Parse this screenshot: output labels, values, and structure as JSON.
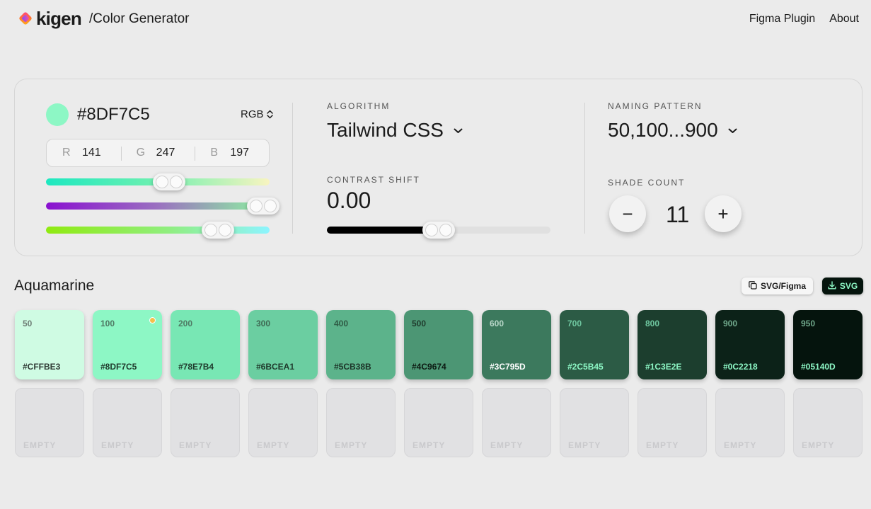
{
  "header": {
    "logo_text": "kigen",
    "title": "/Color Generator",
    "nav": [
      "Figma Plugin",
      "About"
    ]
  },
  "color_input": {
    "hex": "#8DF7C5",
    "swatch_color": "#8DF7C5",
    "mode": "RGB",
    "channels": [
      {
        "label": "R",
        "value": "141"
      },
      {
        "label": "G",
        "value": "247"
      },
      {
        "label": "B",
        "value": "197"
      }
    ],
    "slider_levels": [
      0.55,
      0.97,
      0.77
    ]
  },
  "algorithm": {
    "label": "ALGORITHM",
    "value": "Tailwind CSS"
  },
  "contrast_shift": {
    "label": "CONTRAST SHIFT",
    "value": "0.00",
    "level": 0.5
  },
  "naming_pattern": {
    "label": "NAMING PATTERN",
    "value": "50,100...900"
  },
  "shade_count": {
    "label": "SHADE COUNT",
    "value": "11",
    "decrement": "−",
    "increment": "+"
  },
  "palette": {
    "name": "Aquamarine",
    "export_figma_label": "SVG/Figma",
    "export_svg_label": "SVG",
    "empty_label": "EMPTY",
    "swatches": [
      {
        "shade": "50",
        "hex": "#CFFBE3",
        "bg": "#CFFBE3",
        "fg": "#2f3a34",
        "shade_fg": "#6f7e76"
      },
      {
        "shade": "100",
        "hex": "#8DF7C5",
        "bg": "#8DF7C5",
        "fg": "#1f3a2c",
        "shade_fg": "#4f7a64",
        "base": true
      },
      {
        "shade": "200",
        "hex": "#78E7B4",
        "bg": "#78E7B4",
        "fg": "#1f3a2c",
        "shade_fg": "#4f7a64"
      },
      {
        "shade": "300",
        "hex": "#6BCEA1",
        "bg": "#6BCEA1",
        "fg": "#1f3a2c",
        "shade_fg": "#3f6a54"
      },
      {
        "shade": "400",
        "hex": "#5CB38B",
        "bg": "#5CB38B",
        "fg": "#1c3428",
        "shade_fg": "#2f5a44"
      },
      {
        "shade": "500",
        "hex": "#4C9674",
        "bg": "#4C9674",
        "fg": "#0c1a12",
        "shade_fg": "#1f3a2c"
      },
      {
        "shade": "600",
        "hex": "#3C795D",
        "bg": "#3C795D",
        "fg": "#ffffff",
        "shade_fg": "#b9d7c9"
      },
      {
        "shade": "700",
        "hex": "#2C5B45",
        "bg": "#2C5B45",
        "fg": "#8DF7C5",
        "shade_fg": "#6fc7a0"
      },
      {
        "shade": "800",
        "hex": "#1C3E2E",
        "bg": "#1C3E2E",
        "fg": "#8DF7C5",
        "shade_fg": "#6fc7a0"
      },
      {
        "shade": "900",
        "hex": "#0C2218",
        "bg": "#0C2218",
        "fg": "#8DF7C5",
        "shade_fg": "#6fa78a"
      },
      {
        "shade": "950",
        "hex": "#05140D",
        "bg": "#05140D",
        "fg": "#8DF7C5",
        "shade_fg": "#6fa78a"
      }
    ]
  }
}
